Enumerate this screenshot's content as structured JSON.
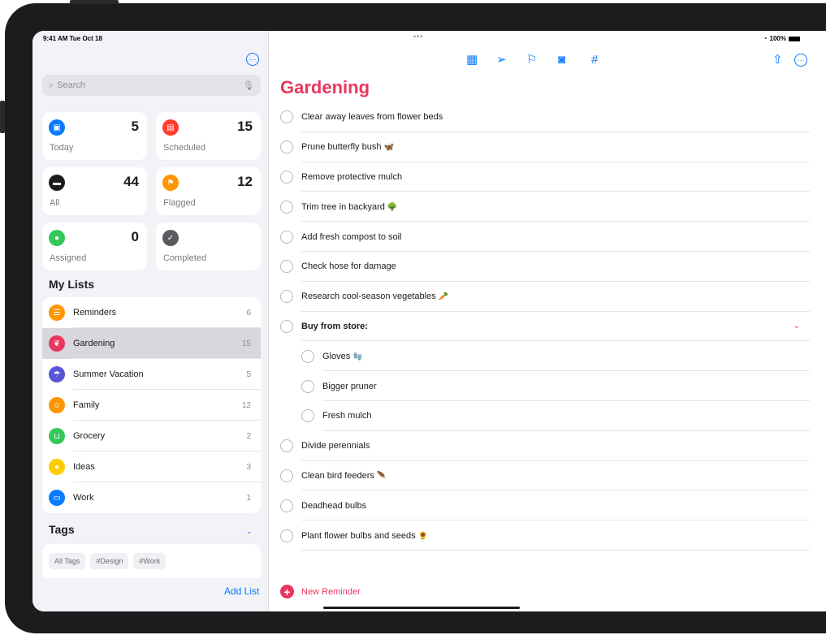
{
  "status": {
    "time": "9:41 AM  Tue Oct 18",
    "battery": "100%",
    "multitask_dots": "•••"
  },
  "sidebar": {
    "more_glyph": "···",
    "search": {
      "placeholder": "Search"
    },
    "smart_lists": [
      {
        "label": "Today",
        "count": "5",
        "color": "#0a7aff",
        "icon": "calendar-icon",
        "glyph": "▣"
      },
      {
        "label": "Scheduled",
        "count": "15",
        "color": "#ff3b30",
        "icon": "calendar-icon",
        "glyph": "▤"
      },
      {
        "label": "All",
        "count": "44",
        "color": "#1c1c1e",
        "icon": "tray-icon",
        "glyph": "▬"
      },
      {
        "label": "Flagged",
        "count": "12",
        "color": "#ff9500",
        "icon": "flag-icon",
        "glyph": "⚑"
      },
      {
        "label": "Assigned",
        "count": "0",
        "color": "#34c759",
        "icon": "person-icon",
        "glyph": "●"
      },
      {
        "label": "Completed",
        "count": "",
        "color": "#5a5a5f",
        "icon": "checkmark-icon",
        "glyph": "✓"
      }
    ],
    "my_lists_title": "My Lists",
    "lists": [
      {
        "name": "Reminders",
        "count": "6",
        "color": "#ff9500",
        "icon": "list-icon",
        "glyph": "☰"
      },
      {
        "name": "Gardening",
        "count": "15",
        "color": "#e8375f",
        "icon": "leaf-icon",
        "glyph": "❦",
        "selected": true
      },
      {
        "name": "Summer Vacation",
        "count": "5",
        "color": "#5856d6",
        "icon": "umbrella-icon",
        "glyph": "☂"
      },
      {
        "name": "Family",
        "count": "12",
        "color": "#ff9500",
        "icon": "family-icon",
        "glyph": "☺"
      },
      {
        "name": "Grocery",
        "count": "2",
        "color": "#34c759",
        "icon": "basket-icon",
        "glyph": "⊔"
      },
      {
        "name": "Ideas",
        "count": "3",
        "color": "#ffcc00",
        "icon": "lightbulb-icon",
        "glyph": "●"
      },
      {
        "name": "Work",
        "count": "1",
        "color": "#0a7aff",
        "icon": "briefcase-icon",
        "glyph": "▭"
      }
    ],
    "tags_title": "Tags",
    "tags": [
      "All Tags",
      "#Design",
      "#Work"
    ],
    "add_list": "Add List"
  },
  "main": {
    "title": "Gardening",
    "title_color": "#e8375f",
    "items": [
      {
        "text": "Clear away leaves from flower beds",
        "emoji": "",
        "level": 0
      },
      {
        "text": "Prune butterfly bush",
        "emoji": "🦋",
        "level": 0
      },
      {
        "text": "Remove protective mulch",
        "emoji": "",
        "level": 0
      },
      {
        "text": "Trim tree in backyard",
        "emoji": "🌳",
        "level": 0
      },
      {
        "text": "Add fresh compost to soil",
        "emoji": "",
        "level": 0
      },
      {
        "text": "Check hose for damage",
        "emoji": "",
        "level": 0
      },
      {
        "text": "Research cool-season vegetables",
        "emoji": "🥕",
        "level": 0
      },
      {
        "text": "Buy from store:",
        "emoji": "",
        "level": 0,
        "bold": true,
        "expanded": true
      },
      {
        "text": "Gloves",
        "emoji": "🧤",
        "level": 1
      },
      {
        "text": "Bigger pruner",
        "emoji": "",
        "level": 1
      },
      {
        "text": "Fresh mulch",
        "emoji": "",
        "level": 1
      },
      {
        "text": "Divide perennials",
        "emoji": "",
        "level": 0
      },
      {
        "text": "Clean bird feeders",
        "emoji": "🪶",
        "level": 0
      },
      {
        "text": "Deadhead bulbs",
        "emoji": "",
        "level": 0
      },
      {
        "text": "Plant flower bulbs and seeds",
        "emoji": "🌻",
        "level": 0
      }
    ],
    "new_reminder": "New Reminder"
  },
  "toolbar_icons": [
    {
      "name": "date-icon",
      "glyph": "▦"
    },
    {
      "name": "location-icon",
      "glyph": "➢"
    },
    {
      "name": "flag-icon",
      "glyph": "⚐"
    },
    {
      "name": "camera-icon",
      "glyph": "◙"
    },
    {
      "name": "tag-icon",
      "glyph": "#"
    },
    {
      "name": "share-icon",
      "glyph": "⇧"
    },
    {
      "name": "more-icon",
      "glyph": "···"
    }
  ]
}
